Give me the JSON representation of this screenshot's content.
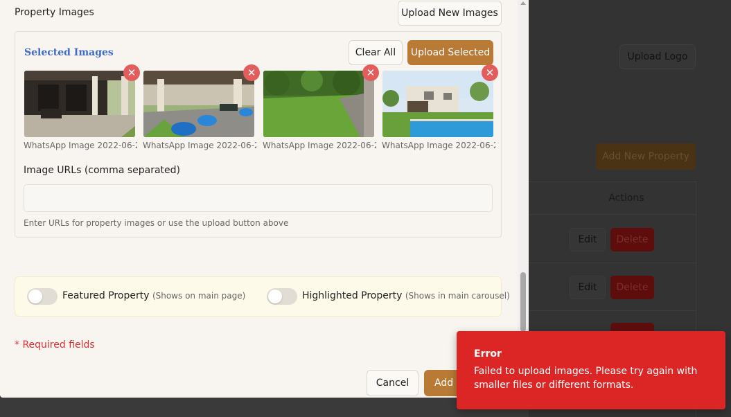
{
  "background": {
    "upload_logo_label": "Upload Logo",
    "add_property_label": "Add New Property",
    "table_header_actions": "Actions",
    "rows": [
      {
        "edit": "Edit",
        "delete": "Delete"
      },
      {
        "edit": "Edit",
        "delete": "Delete"
      },
      {
        "edit": "",
        "delete": ""
      }
    ]
  },
  "modal": {
    "section_title": "Property Images",
    "upload_new_label": "Upload New Images",
    "selected": {
      "title": "Selected Images",
      "clear_all_label": "Clear All",
      "upload_selected_label": "Upload Selected",
      "images": [
        {
          "name": "WhatsApp Image 2022-06-2...",
          "scene": "patio"
        },
        {
          "name": "WhatsApp Image 2022-06-2...",
          "scene": "garden-seating"
        },
        {
          "name": "WhatsApp Image 2022-06-2...",
          "scene": "lawn"
        },
        {
          "name": "WhatsApp Image 2022-06-2...",
          "scene": "villa-pool"
        }
      ],
      "remove_icon": "close-icon"
    },
    "image_urls": {
      "label": "Image URLs (comma separated)",
      "value": "",
      "placeholder": "",
      "help": "Enter URLs for property images or use the upload button above"
    },
    "flags": {
      "featured": {
        "label": "Featured Property",
        "hint": "(Shows on main page)",
        "on": false
      },
      "highlighted": {
        "label": "Highlighted Property",
        "hint": "(Shows in main carousel)",
        "on": false
      }
    },
    "required_note": "* Required fields",
    "cancel_label": "Cancel",
    "submit_label": "Add P"
  },
  "toast": {
    "title": "Error",
    "message": "Failed to upload images. Please try again with smaller files or different formats.",
    "color": "#dc2626"
  },
  "colors": {
    "accent": "#b87a35",
    "link_blue": "#3f6cc4",
    "error": "#d93030"
  }
}
